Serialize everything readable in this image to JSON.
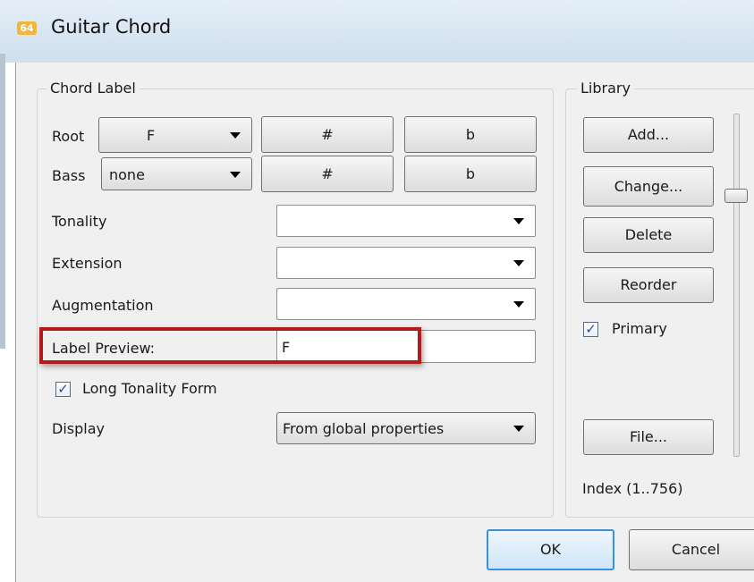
{
  "window": {
    "title": "Guitar Chord",
    "icon_text": "64"
  },
  "chord_label": {
    "group_title": "Chord Label",
    "root": {
      "label": "Root",
      "value": "F",
      "sharp": "#",
      "flat": "b"
    },
    "bass": {
      "label": "Bass",
      "value": "none",
      "sharp": "#",
      "flat": "b"
    },
    "tonality": {
      "label": "Tonality",
      "value": ""
    },
    "extension": {
      "label": "Extension",
      "value": ""
    },
    "augmentation": {
      "label": "Augmentation",
      "value": ""
    },
    "label_preview": {
      "label": "Label Preview:",
      "value": "F"
    },
    "long_tonality": {
      "label": "Long Tonality Form",
      "checked": true
    },
    "display": {
      "label": "Display",
      "value": "From global properties"
    }
  },
  "library": {
    "group_title": "Library",
    "add": "Add...",
    "change": "Change...",
    "delete": "Delete",
    "reorder": "Reorder",
    "primary": {
      "label": "Primary",
      "checked": true
    },
    "file": "File...",
    "index": "Index (1..756)"
  },
  "footer": {
    "ok": "OK",
    "cancel": "Cancel"
  },
  "colors": {
    "highlight": "#b31b1b",
    "check": "#1e4fa6"
  }
}
